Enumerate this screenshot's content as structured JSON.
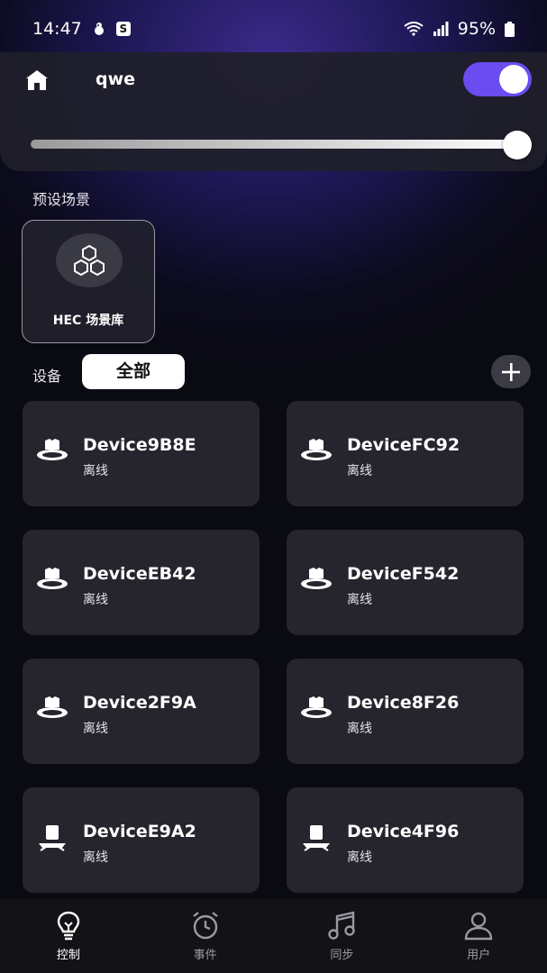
{
  "status_bar": {
    "time": "14:47",
    "app_badge": "S",
    "battery": "95%"
  },
  "header": {
    "room_name": "qwe",
    "power_on": true,
    "brightness_percent": 100
  },
  "scenes": {
    "title": "预设场景",
    "items": [
      {
        "label": "HEC 场景库",
        "icon": "hexagon-cluster-icon"
      }
    ]
  },
  "devices": {
    "title": "设备",
    "filter_label": "全部",
    "items": [
      {
        "name": "Device9B8E",
        "status": "离线",
        "icon": "downlight-icon"
      },
      {
        "name": "DeviceFC92",
        "status": "离线",
        "icon": "downlight-icon"
      },
      {
        "name": "DeviceEB42",
        "status": "离线",
        "icon": "downlight-icon"
      },
      {
        "name": "DeviceF542",
        "status": "离线",
        "icon": "downlight-icon"
      },
      {
        "name": "Device2F9A",
        "status": "离线",
        "icon": "downlight-icon"
      },
      {
        "name": "Device8F26",
        "status": "离线",
        "icon": "downlight-icon"
      },
      {
        "name": "DeviceE9A2",
        "status": "离线",
        "icon": "spotlight-icon"
      },
      {
        "name": "Device4F96",
        "status": "离线",
        "icon": "spotlight-icon"
      }
    ]
  },
  "tab_bar": {
    "tabs": [
      {
        "label": "控制",
        "icon": "lightbulb-icon",
        "active": true
      },
      {
        "label": "事件",
        "icon": "alarm-clock-icon",
        "active": false
      },
      {
        "label": "同步",
        "icon": "music-note-icon",
        "active": false
      },
      {
        "label": "用户",
        "icon": "user-icon",
        "active": false
      }
    ]
  },
  "colors": {
    "accent": "#6a4cf0",
    "card": "#26252d",
    "tab_bar": "#131216"
  }
}
